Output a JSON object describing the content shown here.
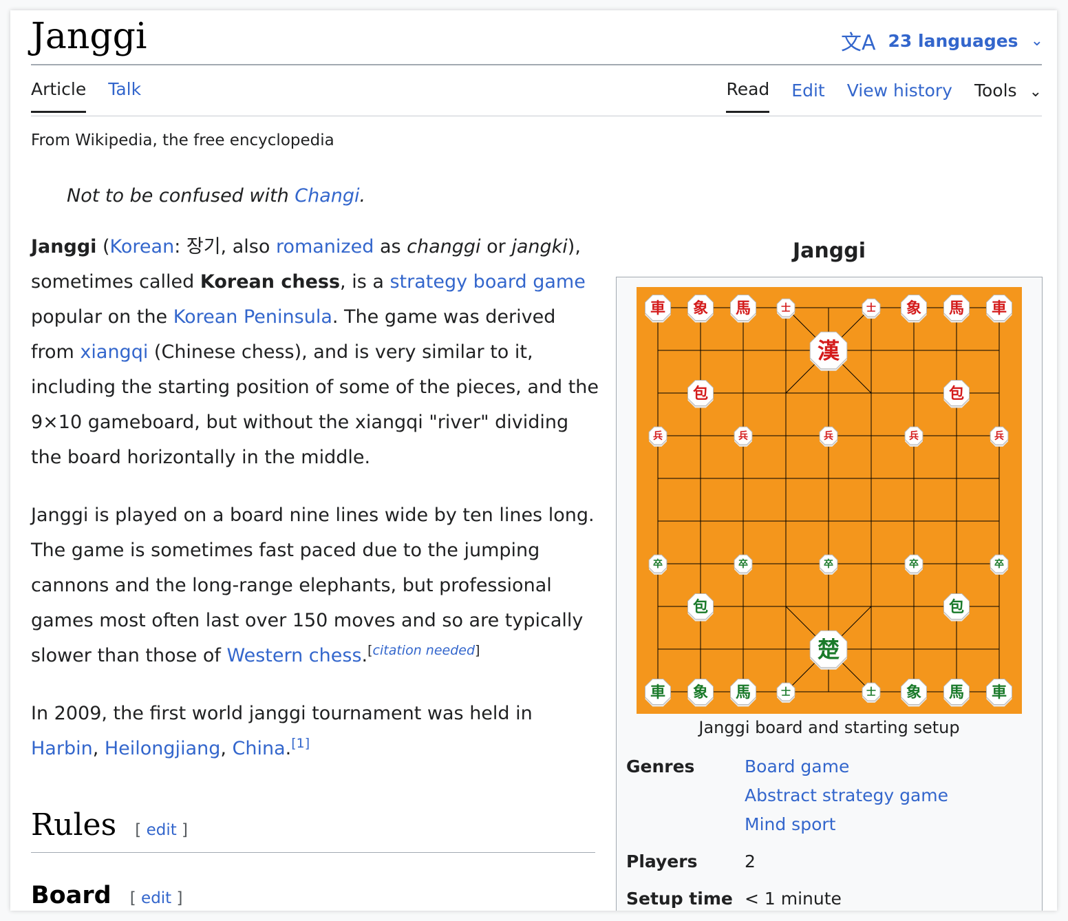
{
  "page": {
    "title": "Janggi",
    "languages_label": "23 languages",
    "tabs_left": [
      "Article",
      "Talk"
    ],
    "tabs_right": [
      "Read",
      "Edit",
      "View history",
      "Tools"
    ],
    "tagline": "From Wikipedia, the free encyclopedia",
    "hatnote_prefix": "Not to be confused with ",
    "hatnote_link": "Changi",
    "hatnote_suffix": "."
  },
  "article": {
    "p1": {
      "bold1": "Janggi",
      "t1": " (",
      "l_korean": "Korean",
      "t2": ": 장기, also ",
      "l_romanized": "romanized",
      "t3": " as ",
      "i1": "changgi",
      "t4": " or ",
      "i2": "jangki",
      "t5": "), sometimes called ",
      "bold2": "Korean chess",
      "t6": ", is a ",
      "l_strategy": "strategy board game",
      "t7": " popular on the ",
      "l_peninsula": "Korean Peninsula",
      "t8": ". The game was derived from ",
      "l_xiangqi": "xiangqi",
      "t9": " (Chinese chess), and is very similar to it, including the starting position of some of the pieces, and the 9×10 gameboard, but without the xiangqi \"river\" dividing the board horizontally in the middle."
    },
    "p2": {
      "t1": "Janggi is played on a board nine lines wide by ten lines long. The game is sometimes fast paced due to the jumping cannons and the long-range elephants, but professional games most often last over 150 moves and so are typically slower than those of ",
      "l_western": "Western chess",
      "t2": ".",
      "cite_open": "[",
      "cite": "citation needed",
      "cite_close": "]"
    },
    "p3": {
      "t1": "In 2009, the first world janggi tournament was held in ",
      "l_harbin": "Harbin",
      "sep1": ", ",
      "l_heilongjiang": "Heilongjiang",
      "sep2": ", ",
      "l_china": "China",
      "t2": ".",
      "ref": "[1]"
    },
    "h2": "Rules",
    "h3": "Board",
    "edit_open": "[ ",
    "edit_label": "edit",
    "edit_close": " ]"
  },
  "infobox": {
    "caption": "Janggi",
    "image_caption": "Janggi board and starting setup",
    "genres_label": "Genres",
    "genres": [
      "Board game",
      "Abstract strategy game",
      "Mind sport"
    ],
    "players_label": "Players",
    "players": "2",
    "setup_label": "Setup time",
    "setup": "< 1 minute"
  },
  "board": {
    "background": "#f4961c",
    "red": "#d41c1c",
    "green": "#1a7a2a",
    "pieces": [
      {
        "side": "red",
        "ch": "車",
        "col": 0,
        "row": 0,
        "size": "m"
      },
      {
        "side": "red",
        "ch": "象",
        "col": 1,
        "row": 0,
        "size": "m"
      },
      {
        "side": "red",
        "ch": "馬",
        "col": 2,
        "row": 0,
        "size": "m"
      },
      {
        "side": "red",
        "ch": "士",
        "col": 3,
        "row": 0,
        "size": "s"
      },
      {
        "side": "red",
        "ch": "士",
        "col": 5,
        "row": 0,
        "size": "s"
      },
      {
        "side": "red",
        "ch": "象",
        "col": 6,
        "row": 0,
        "size": "m"
      },
      {
        "side": "red",
        "ch": "馬",
        "col": 7,
        "row": 0,
        "size": "m"
      },
      {
        "side": "red",
        "ch": "車",
        "col": 8,
        "row": 0,
        "size": "m"
      },
      {
        "side": "red",
        "ch": "漢",
        "col": 4,
        "row": 1,
        "size": "l"
      },
      {
        "side": "red",
        "ch": "包",
        "col": 1,
        "row": 2,
        "size": "m"
      },
      {
        "side": "red",
        "ch": "包",
        "col": 7,
        "row": 2,
        "size": "m"
      },
      {
        "side": "red",
        "ch": "兵",
        "col": 0,
        "row": 3,
        "size": "s"
      },
      {
        "side": "red",
        "ch": "兵",
        "col": 2,
        "row": 3,
        "size": "s"
      },
      {
        "side": "red",
        "ch": "兵",
        "col": 4,
        "row": 3,
        "size": "s"
      },
      {
        "side": "red",
        "ch": "兵",
        "col": 6,
        "row": 3,
        "size": "s"
      },
      {
        "side": "red",
        "ch": "兵",
        "col": 8,
        "row": 3,
        "size": "s"
      },
      {
        "side": "green",
        "ch": "卒",
        "col": 0,
        "row": 6,
        "size": "s"
      },
      {
        "side": "green",
        "ch": "卒",
        "col": 2,
        "row": 6,
        "size": "s"
      },
      {
        "side": "green",
        "ch": "卒",
        "col": 4,
        "row": 6,
        "size": "s"
      },
      {
        "side": "green",
        "ch": "卒",
        "col": 6,
        "row": 6,
        "size": "s"
      },
      {
        "side": "green",
        "ch": "卒",
        "col": 8,
        "row": 6,
        "size": "s"
      },
      {
        "side": "green",
        "ch": "包",
        "col": 1,
        "row": 7,
        "size": "m"
      },
      {
        "side": "green",
        "ch": "包",
        "col": 7,
        "row": 7,
        "size": "m"
      },
      {
        "side": "green",
        "ch": "楚",
        "col": 4,
        "row": 8,
        "size": "l"
      },
      {
        "side": "green",
        "ch": "車",
        "col": 0,
        "row": 9,
        "size": "m"
      },
      {
        "side": "green",
        "ch": "象",
        "col": 1,
        "row": 9,
        "size": "m"
      },
      {
        "side": "green",
        "ch": "馬",
        "col": 2,
        "row": 9,
        "size": "m"
      },
      {
        "side": "green",
        "ch": "士",
        "col": 3,
        "row": 9,
        "size": "s"
      },
      {
        "side": "green",
        "ch": "士",
        "col": 5,
        "row": 9,
        "size": "s"
      },
      {
        "side": "green",
        "ch": "象",
        "col": 6,
        "row": 9,
        "size": "m"
      },
      {
        "side": "green",
        "ch": "馬",
        "col": 7,
        "row": 9,
        "size": "m"
      },
      {
        "side": "green",
        "ch": "車",
        "col": 8,
        "row": 9,
        "size": "m"
      }
    ]
  }
}
